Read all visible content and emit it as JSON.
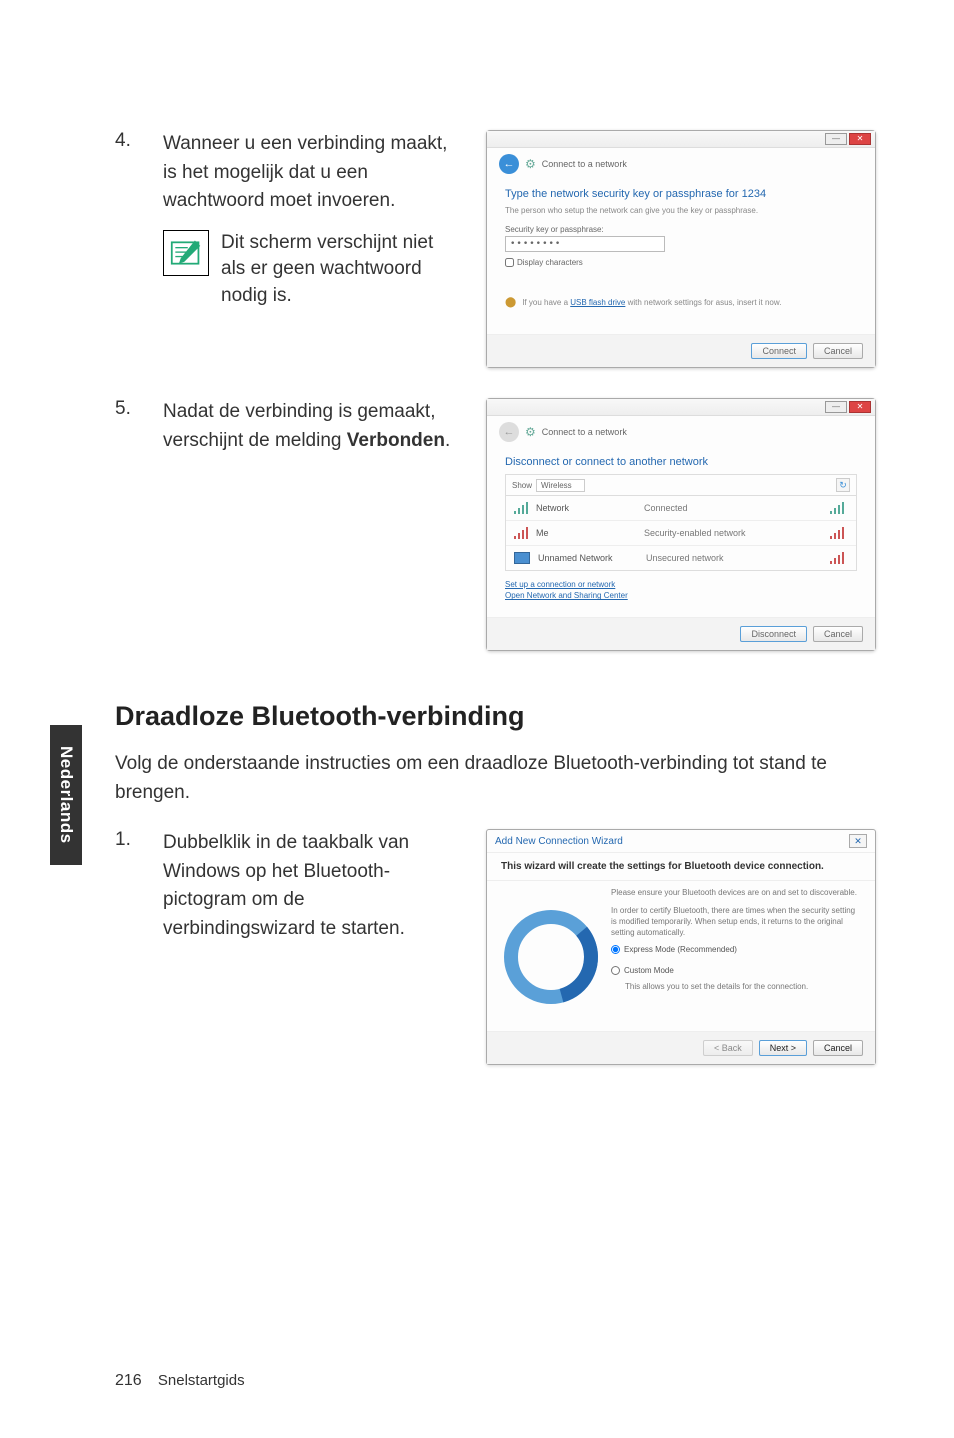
{
  "side_tab": "Nederlands",
  "step4": {
    "num": "4.",
    "text": "Wanneer u een verbinding maakt, is het mogelijk dat u een wachtwoord moet invoeren.",
    "note": "Dit scherm verschijnt niet als er geen wachtwoord nodig is."
  },
  "dlg1": {
    "back_label": "Connect to a network",
    "heading": "Type the network security key or passphrase for 1234",
    "sub": "The person who setup the network can give you the key or passphrase.",
    "label1": "Security key or passphrase:",
    "input1": "••••••••",
    "check1": "Display characters",
    "info": "If you have a USB flash drive with network settings for asus, insert it now.",
    "btn_connect": "Connect",
    "btn_cancel": "Cancel"
  },
  "step5": {
    "num": "5.",
    "text_before": "Nadat de verbinding is gemaakt, verschijnt de melding ",
    "text_bold": "Verbonden",
    "text_after": "."
  },
  "dlg2": {
    "back_label": "Connect to a network",
    "heading": "Disconnect or connect to another network",
    "filter_label": "Show",
    "filter_value": "Wireless",
    "row1_name": "Network",
    "row1_status": "Connected",
    "row2_name": "Me",
    "row2_status": "Security-enabled network",
    "row3_name": "Unnamed Network",
    "row3_status": "Unsecured network",
    "link1": "Set up a connection or network",
    "link2": "Open Network and Sharing Center",
    "btn_disconnect": "Disconnect",
    "btn_cancel": "Cancel"
  },
  "section": {
    "heading": "Draadloze Bluetooth-verbinding",
    "intro": "Volg de onderstaande instructies om een draadloze Bluetooth-verbinding tot stand te brengen."
  },
  "step1": {
    "num": "1.",
    "text": "Dubbelklik in de taakbalk van Windows op het Bluetooth-pictogram om de verbindingswizard te starten."
  },
  "bt": {
    "title": "Add New Connection Wizard",
    "heading": "This wizard will create the settings for Bluetooth device connection.",
    "para1": "Please ensure your Bluetooth devices are on and set to discoverable.",
    "para1b": "In order to certify Bluetooth, there are times when the security setting is modified temporarily. When setup ends, it returns to the original setting automatically.",
    "radio1": "Express Mode (Recommended)",
    "radio2": "Custom Mode",
    "para2": "This allows you to set the details for the connection.",
    "btn_back": "< Back",
    "btn_next": "Next >",
    "btn_cancel": "Cancel"
  },
  "footer": {
    "page": "216",
    "title": "Snelstartgids"
  }
}
